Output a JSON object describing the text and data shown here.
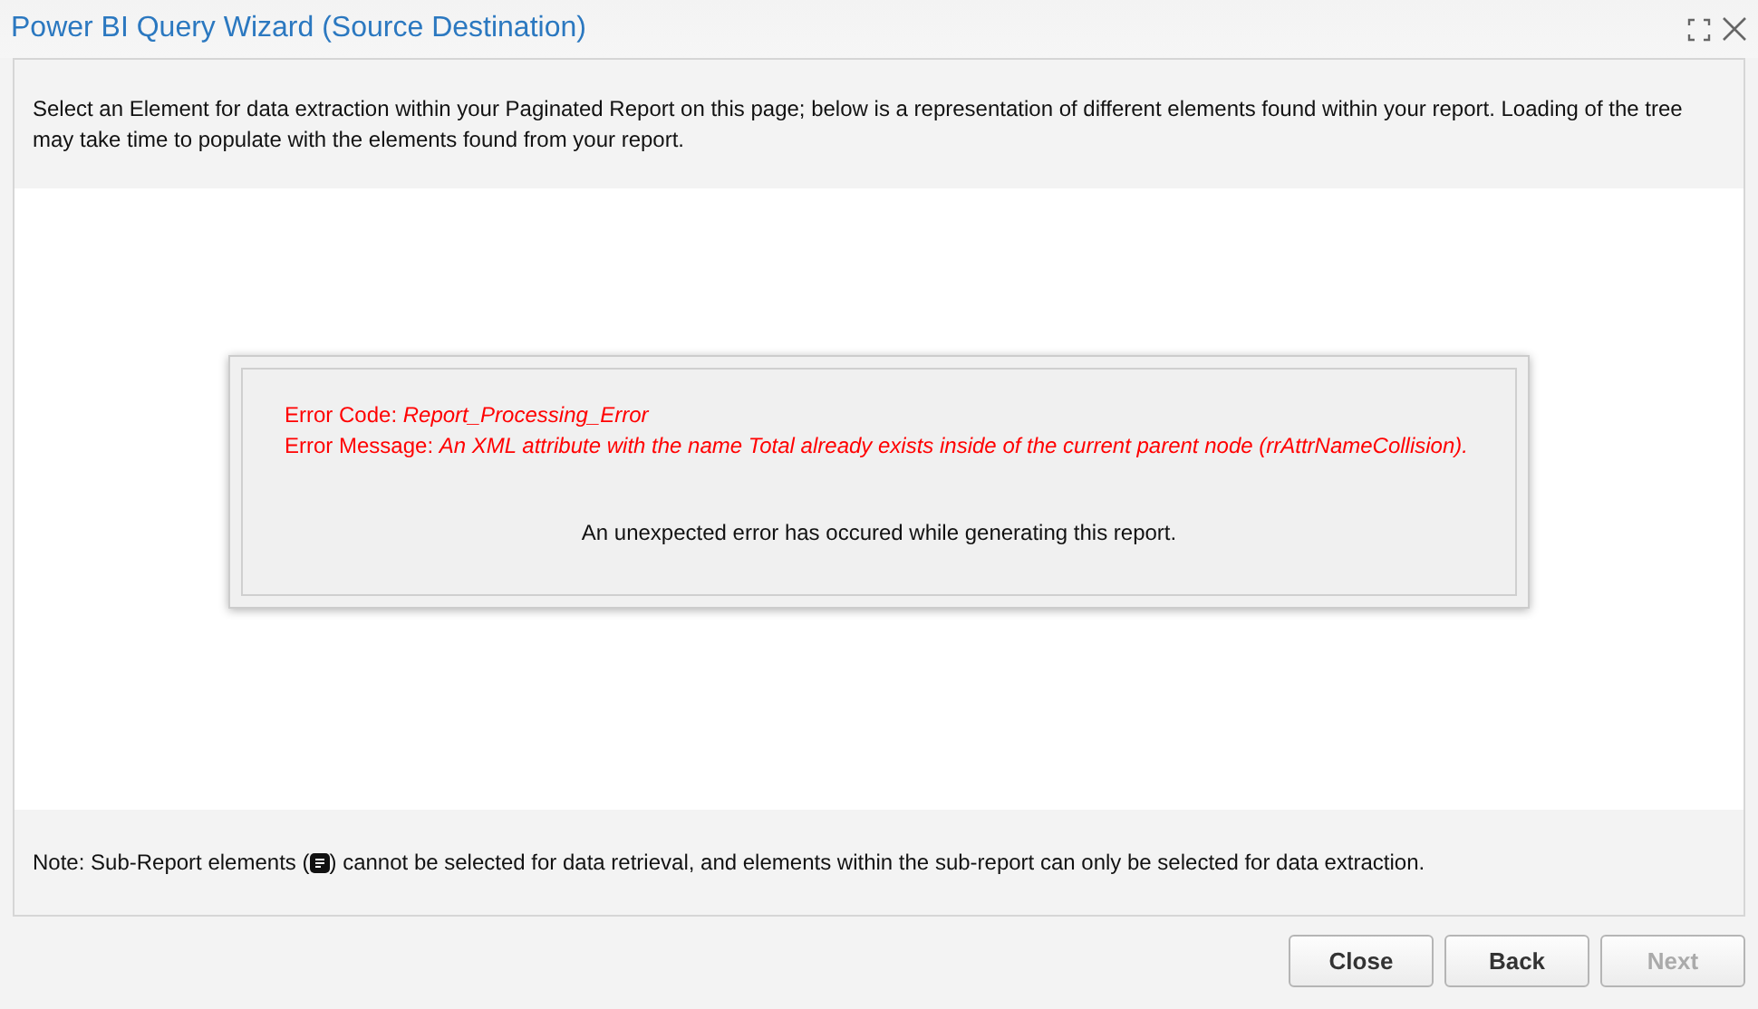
{
  "window": {
    "title": "Power BI Query Wizard (Source Destination)"
  },
  "intro": "Select an Element for data extraction within your Paginated Report on this page; below is a representation of different elements found within your report. Loading of the tree may take time to populate with the elements found from your report.",
  "error": {
    "lines": [
      "Error Code: *Report_Processing_Error*",
      "Error Message: *An XML attribute with the name Total already exists inside of the current parent node (rrAttrNameCollision).*"
    ],
    "message": "An unexpected error has occured while generating this report."
  },
  "note": {
    "before": "Note: Sub-Report elements (",
    "after": ") cannot be selected for data retrieval, and elements within the sub-report can only be selected for data extraction."
  },
  "buttons": [
    {
      "label": "Close",
      "disabled": false
    },
    {
      "label": "Back",
      "disabled": false
    },
    {
      "label": "Next",
      "disabled": true
    }
  ]
}
